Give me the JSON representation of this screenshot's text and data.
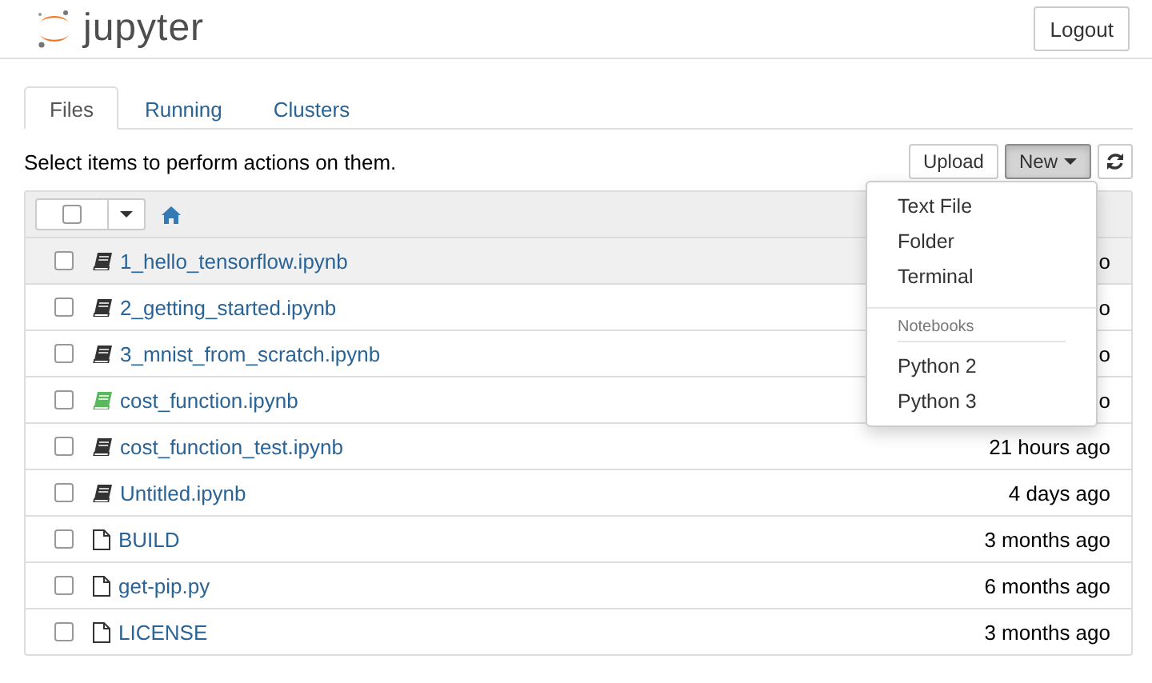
{
  "header": {
    "logo_text": "jupyter",
    "logout": "Logout"
  },
  "tabs": [
    {
      "label": "Files",
      "selected": true
    },
    {
      "label": "Running",
      "selected": false
    },
    {
      "label": "Clusters",
      "selected": false
    }
  ],
  "toolbar": {
    "hint": "Select items to perform actions on them.",
    "upload": "Upload",
    "new": "New",
    "new_open": true
  },
  "files": [
    {
      "name": "1_hello_tensorflow.ipynb",
      "kind": "notebook",
      "running": false,
      "checked": false,
      "highlighted": true,
      "modified": "o"
    },
    {
      "name": "2_getting_started.ipynb",
      "kind": "notebook",
      "running": false,
      "checked": false,
      "highlighted": false,
      "modified": "o"
    },
    {
      "name": "3_mnist_from_scratch.ipynb",
      "kind": "notebook",
      "running": false,
      "checked": false,
      "highlighted": false,
      "modified": "o"
    },
    {
      "name": "cost_function.ipynb",
      "kind": "notebook",
      "running": true,
      "checked": false,
      "highlighted": false,
      "modified": "o"
    },
    {
      "name": "cost_function_test.ipynb",
      "kind": "notebook",
      "running": false,
      "checked": false,
      "highlighted": false,
      "modified": "21 hours ago"
    },
    {
      "name": "Untitled.ipynb",
      "kind": "notebook",
      "running": false,
      "checked": false,
      "highlighted": false,
      "modified": "4 days ago"
    },
    {
      "name": "BUILD",
      "kind": "file",
      "running": false,
      "checked": false,
      "highlighted": false,
      "modified": "3 months ago"
    },
    {
      "name": "get-pip.py",
      "kind": "file",
      "running": false,
      "checked": false,
      "highlighted": false,
      "modified": "6 months ago"
    },
    {
      "name": "LICENSE",
      "kind": "file",
      "running": false,
      "checked": false,
      "highlighted": false,
      "modified": "3 months ago"
    }
  ],
  "new_menu": [
    {
      "kind": "item",
      "label": "Text File"
    },
    {
      "kind": "item",
      "label": "Folder"
    },
    {
      "kind": "item",
      "label": "Terminal"
    },
    {
      "kind": "divider"
    },
    {
      "kind": "header",
      "label": "Notebooks"
    },
    {
      "kind": "item",
      "label": "Python 2"
    },
    {
      "kind": "item",
      "label": "Python 3"
    }
  ]
}
